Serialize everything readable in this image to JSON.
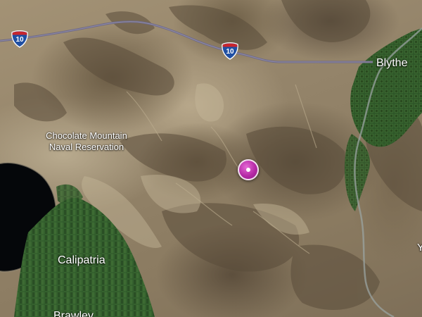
{
  "map": {
    "labels": {
      "blythe": "Blythe",
      "reservation_line1": "Chocolate Mountain",
      "reservation_line2": "Naval Reservation",
      "calipatria": "Calipatria",
      "brawley": "Brawley",
      "edge_partial": "Y"
    },
    "highway": {
      "shield_1": "10",
      "shield_2": "10"
    },
    "marker": {
      "icon": "location-pin-icon",
      "color": "#b52aa6"
    },
    "colors": {
      "water": "#05070a",
      "farmland": "#2f5a2a",
      "highway": "#6e6a86",
      "shield_blue": "#1f4fa3",
      "shield_red": "#c8262e"
    }
  }
}
